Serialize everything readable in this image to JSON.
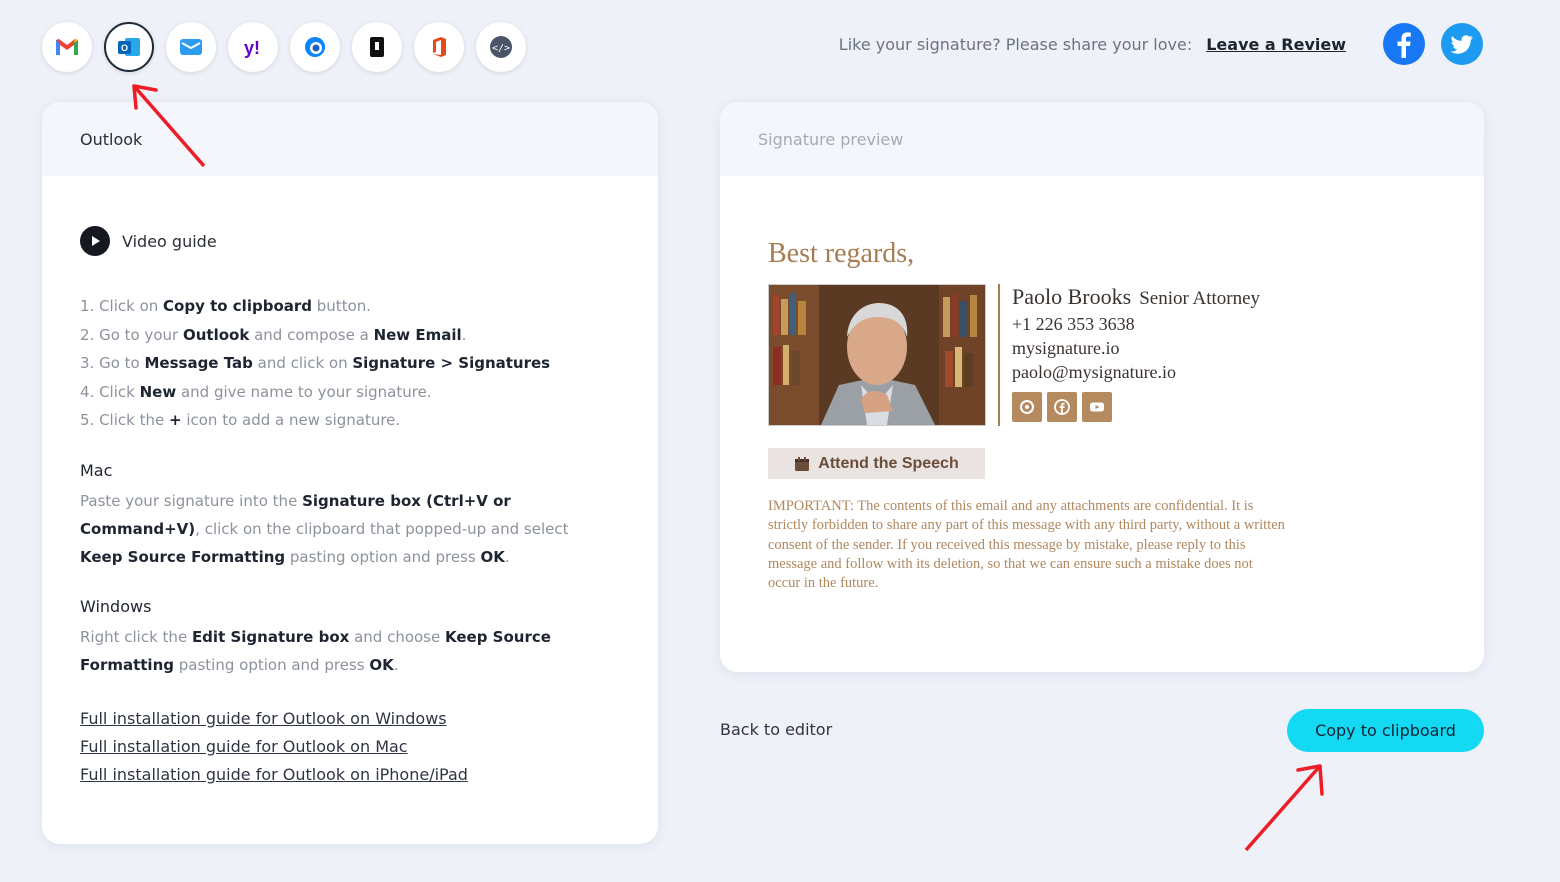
{
  "clients": [
    {
      "name": "gmail-icon",
      "active": false
    },
    {
      "name": "outlook-icon",
      "active": true
    },
    {
      "name": "mail-app-icon",
      "active": false
    },
    {
      "name": "yahoo-icon",
      "active": false
    },
    {
      "name": "thunderbird-icon",
      "active": false
    },
    {
      "name": "apple-mail-icon",
      "active": false
    },
    {
      "name": "office365-icon",
      "active": false
    },
    {
      "name": "html-code-icon",
      "active": false
    }
  ],
  "share": {
    "text": "Like your signature? Please share your love:",
    "review_link": "Leave a Review",
    "facebook_color": "#1877f2",
    "twitter_color": "#1d9bf0"
  },
  "left_panel": {
    "title": "Outlook",
    "video_label": "Video guide",
    "steps": [
      [
        "1. Click on ",
        "Copy to clipboard",
        " button."
      ],
      [
        "2. Go to your ",
        "Outlook",
        " and compose a ",
        "New Email",
        "."
      ],
      [
        "3. Go to ",
        "Message Tab",
        " and click on ",
        "Signature > Signatures"
      ],
      [
        "4. Click ",
        "New",
        " and give name to your signature."
      ],
      [
        "5. Click the ",
        "+",
        " icon to add a new signature."
      ]
    ],
    "mac": {
      "title": "Mac",
      "parts": [
        "Paste your signature into the ",
        "Signature box (Ctrl+V or Command+V)",
        ", click on the clipboard that popped-up and select ",
        "Keep Source Formatting",
        " pasting option and press ",
        "OK",
        "."
      ]
    },
    "windows": {
      "title": "Windows",
      "parts": [
        "Right click the ",
        "Edit Signature box",
        " and choose ",
        "Keep Source Formatting",
        " pasting option and press ",
        "OK",
        "."
      ]
    },
    "links": [
      "Full installation guide for Outlook on Windows",
      "Full installation guide for Outlook on Mac",
      "Full installation guide for Outlook on iPhone/iPad"
    ]
  },
  "preview": {
    "title": "Signature preview",
    "regards": "Best regards,",
    "name": "Paolo Brooks",
    "job_title": "Senior Attorney",
    "phone": "+1 226 353 3638",
    "website": "mysignature.io",
    "email": "paolo@mysignature.io",
    "cta": "Attend the Speech",
    "disclaimer": "IMPORTANT: The contents of this email and any attachments are confidential. It is strictly forbidden to share any part of this message with any third party, without a written consent of the sender. If you received this message by mistake, please reply to this message and follow with its deletion, so that we can ensure such a mistake does not occur in the future.",
    "accent_color": "#a67c52"
  },
  "actions": {
    "back": "Back to editor",
    "copy": "Copy to clipboard",
    "copy_color": "#14d9f2"
  }
}
